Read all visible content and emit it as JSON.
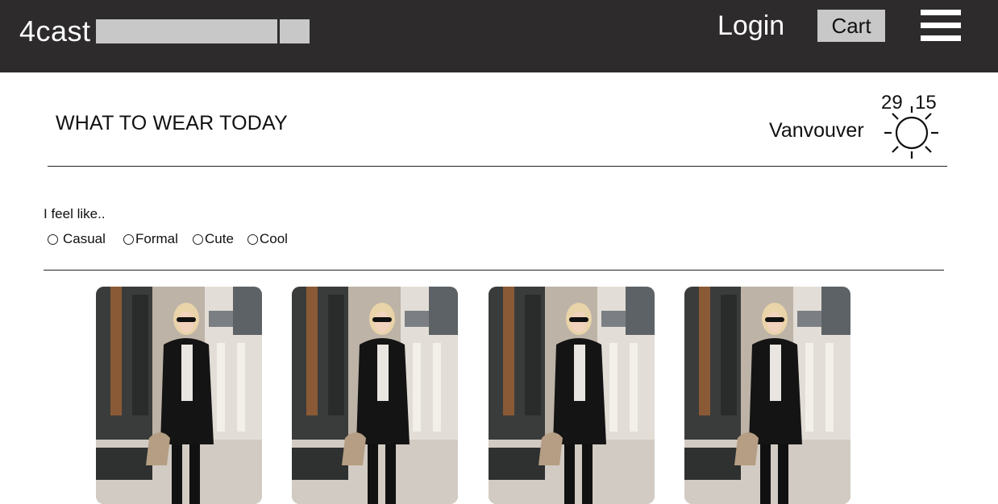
{
  "header": {
    "logo": "4cast",
    "search_placeholder": "",
    "login_label": "Login",
    "cart_label": "Cart"
  },
  "weather_banner": {
    "title": "WHAT TO WEAR TODAY",
    "city": "Vanvouver",
    "temp_high": "29",
    "temp_low": "15",
    "condition_icon": "sun-icon"
  },
  "mood": {
    "prompt": "I feel like..",
    "options": [
      {
        "label": "Casual",
        "selected": false
      },
      {
        "label": "Formal",
        "selected": false
      },
      {
        "label": "Cute",
        "selected": false
      },
      {
        "label": "Cool",
        "selected": false
      }
    ]
  },
  "outfits": [
    {
      "name": "outfit-1",
      "icon": "outfit-photo"
    },
    {
      "name": "outfit-2",
      "icon": "outfit-photo"
    },
    {
      "name": "outfit-3",
      "icon": "outfit-photo"
    },
    {
      "name": "outfit-4",
      "icon": "outfit-photo"
    }
  ],
  "colors": {
    "header_bg": "#2d2b2b",
    "control_gray": "#c8c8c8",
    "text": "#111111"
  }
}
